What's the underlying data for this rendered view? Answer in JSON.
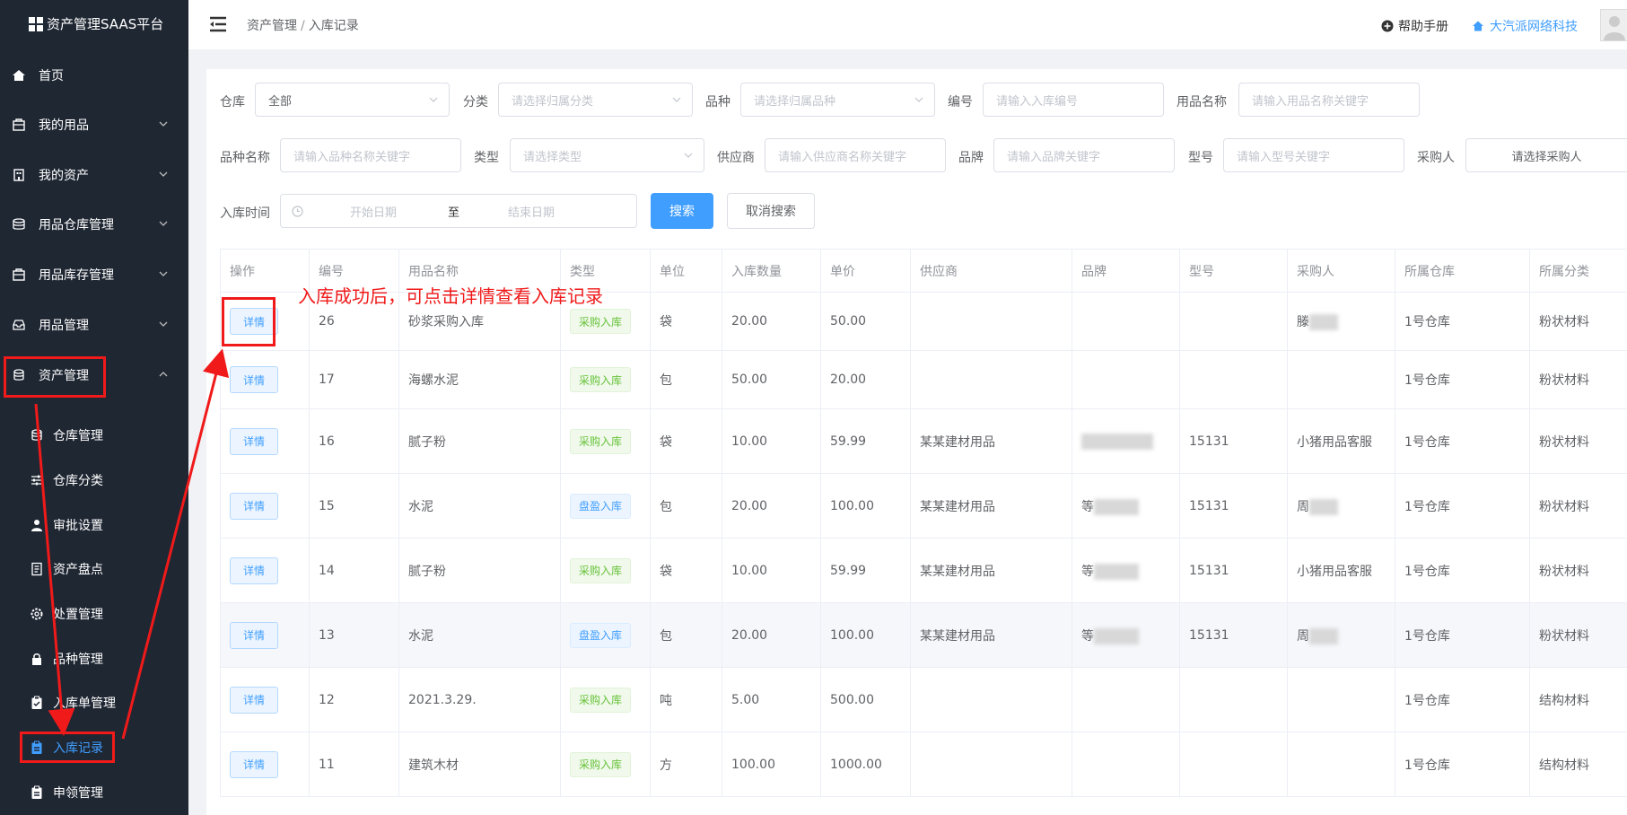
{
  "app": {
    "logo_text": "资产管理SAAS平台"
  },
  "sidebar": {
    "items": [
      {
        "label": "首页",
        "icon": "home-icon"
      },
      {
        "label": "我的用品",
        "icon": "bag-icon"
      },
      {
        "label": "我的资产",
        "icon": "building-icon"
      },
      {
        "label": "用品仓库管理",
        "icon": "database-icon"
      },
      {
        "label": "用品库存管理",
        "icon": "bag-icon"
      },
      {
        "label": "用品管理",
        "icon": "inbox-icon"
      },
      {
        "label": "资产管理",
        "icon": "asset-icon",
        "expanded": true
      }
    ],
    "sub_items": [
      {
        "label": "仓库管理",
        "icon": "database-icon"
      },
      {
        "label": "仓库分类",
        "icon": "sliders-icon"
      },
      {
        "label": "审批设置",
        "icon": "user-icon"
      },
      {
        "label": "资产盘点",
        "icon": "document-icon"
      },
      {
        "label": "处置管理",
        "icon": "gear-icon"
      },
      {
        "label": "品种管理",
        "icon": "lock-icon"
      },
      {
        "label": "入库单管理",
        "icon": "clipboard-icon"
      },
      {
        "label": "入库记录",
        "icon": "clipboard-icon",
        "active": true
      },
      {
        "label": "申领管理",
        "icon": "clipboard-icon"
      }
    ]
  },
  "header": {
    "breadcrumb": [
      "资产管理",
      "入库记录"
    ],
    "help_label": "帮助手册",
    "company_label": "大汽派网络科技"
  },
  "filters": {
    "warehouse": {
      "label": "仓库",
      "value": "全部"
    },
    "category": {
      "label": "分类",
      "placeholder": "请选择归属分类"
    },
    "variety": {
      "label": "品种",
      "placeholder": "请选择归属品种"
    },
    "number": {
      "label": "编号",
      "placeholder": "请输入入库编号"
    },
    "item_name": {
      "label": "用品名称",
      "placeholder": "请输入用品名称关键字"
    },
    "variety_name": {
      "label": "品种名称",
      "placeholder": "请输入品种名称关键字"
    },
    "type": {
      "label": "类型",
      "placeholder": "请选择类型"
    },
    "supplier": {
      "label": "供应商",
      "placeholder": "请输入供应商名称关键字"
    },
    "brand": {
      "label": "品牌",
      "placeholder": "请输入品牌关键字"
    },
    "model": {
      "label": "型号",
      "placeholder": "请输入型号关键字"
    },
    "buyer": {
      "label": "采购人",
      "placeholder": "请选择采购人"
    },
    "date": {
      "label": "入库时间",
      "start_placeholder": "开始日期",
      "separator": "至",
      "end_placeholder": "结束日期"
    },
    "search_label": "搜索",
    "cancel_label": "取消搜索"
  },
  "table": {
    "columns": [
      "操作",
      "编号",
      "用品名称",
      "类型",
      "单位",
      "入库数量",
      "单价",
      "供应商",
      "品牌",
      "型号",
      "采购人",
      "所属仓库",
      "所属分类"
    ],
    "detail_label": "详情",
    "rows": [
      {
        "id": "26",
        "name": "砂浆采购入库",
        "type": "采购入库",
        "tag": "green",
        "unit": "袋",
        "qty": "20.00",
        "price": "50.00",
        "supplier": "",
        "brand": "",
        "model": "",
        "buyer": "滕",
        "warehouse": "1号仓库",
        "category": "粉状材料"
      },
      {
        "id": "17",
        "name": "海螺水泥",
        "type": "采购入库",
        "tag": "green",
        "unit": "包",
        "qty": "50.00",
        "price": "20.00",
        "supplier": "",
        "brand": "",
        "model": "",
        "buyer": "",
        "warehouse": "1号仓库",
        "category": "粉状材料"
      },
      {
        "id": "16",
        "name": "腻子粉",
        "type": "采购入库",
        "tag": "green",
        "unit": "袋",
        "qty": "10.00",
        "price": "59.99",
        "supplier": "某某建材用品",
        "brand": "",
        "model": "15131",
        "buyer": "小猪用品客服",
        "warehouse": "1号仓库",
        "category": "粉状材料"
      },
      {
        "id": "15",
        "name": "水泥",
        "type": "盘盈入库",
        "tag": "blue",
        "unit": "包",
        "qty": "20.00",
        "price": "100.00",
        "supplier": "某某建材用品",
        "brand": "等",
        "model": "15131",
        "buyer": "周",
        "warehouse": "1号仓库",
        "category": "粉状材料"
      },
      {
        "id": "14",
        "name": "腻子粉",
        "type": "采购入库",
        "tag": "green",
        "unit": "袋",
        "qty": "10.00",
        "price": "59.99",
        "supplier": "某某建材用品",
        "brand": "等",
        "model": "15131",
        "buyer": "小猪用品客服",
        "warehouse": "1号仓库",
        "category": "粉状材料"
      },
      {
        "id": "13",
        "name": "水泥",
        "type": "盘盈入库",
        "tag": "blue",
        "unit": "包",
        "qty": "20.00",
        "price": "100.00",
        "supplier": "某某建材用品",
        "brand": "等",
        "model": "15131",
        "buyer": "周",
        "warehouse": "1号仓库",
        "category": "粉状材料"
      },
      {
        "id": "12",
        "name": "2021.3.29.",
        "type": "采购入库",
        "tag": "green",
        "unit": "吨",
        "qty": "5.00",
        "price": "500.00",
        "supplier": "",
        "brand": "",
        "model": "",
        "buyer": "",
        "warehouse": "1号仓库",
        "category": "结构材料"
      },
      {
        "id": "11",
        "name": "建筑木材",
        "type": "采购入库",
        "tag": "green",
        "unit": "方",
        "qty": "100.00",
        "price": "1000.00",
        "supplier": "",
        "brand": "",
        "model": "",
        "buyer": "",
        "warehouse": "1号仓库",
        "category": "结构材料"
      }
    ]
  },
  "annotation": {
    "text": "入库成功后，可点击详情查看入库记录"
  },
  "colors": {
    "sidebar_bg": "#1f2733",
    "primary": "#409eff",
    "annotation_red": "#f01a1a"
  }
}
